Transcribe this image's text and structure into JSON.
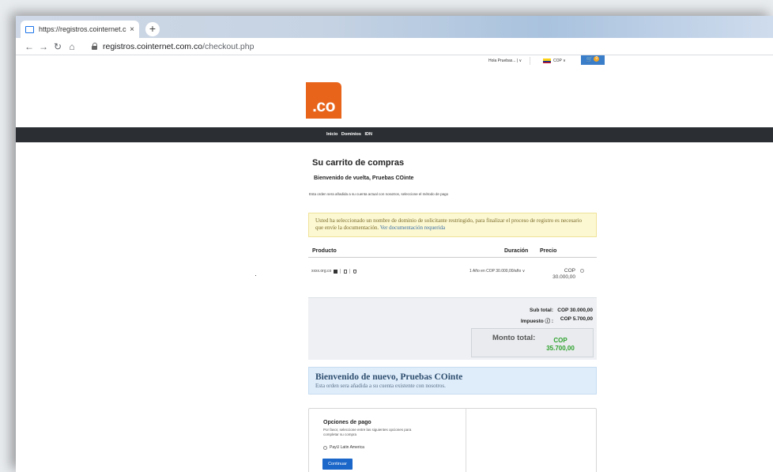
{
  "browser": {
    "tab_title": "https://registros.cointernet.com.co",
    "tab_close": "×",
    "new_tab": "+",
    "url_host": "registros.cointernet.com.co",
    "url_path": "/checkout.php",
    "icons": [
      "back-arrow-icon",
      "forward-arrow-icon",
      "reload-icon",
      "home-icon",
      "lock-icon"
    ]
  },
  "topbar": {
    "greeting": "Hola Pruebas... | ∨",
    "currency": "COP ∨",
    "cart_count": "0"
  },
  "brand": {
    "logo_text": ".co",
    "logo_color": "#e8641b"
  },
  "nav": {
    "items": [
      "Inicio",
      "Dominios",
      "IDN"
    ]
  },
  "cart": {
    "title": "Su carrito de compras",
    "welcome": "Bienvenido de vuelta, Pruebas COinte",
    "note": "Esta orden sera añadida a su cuenta actual con nosotros, seleccione el método de pago",
    "alert_text": "Usted ha seleccionado un nombre de dominio de solicitante restringido, para finalizar el proceso de registro es necesario que envíe la documentación.",
    "alert_link": "Ver documentación requerida",
    "columns": {
      "product": "Producto",
      "duration": "Duración",
      "price": "Precio"
    },
    "items": [
      {
        "domain": "xxxx.org.co",
        "duration": "1 Año en COP 30.000,00/año ∨",
        "price": "COP 30.000,00"
      }
    ],
    "subtotal_label": "Sub total:",
    "subtotal_value": "COP 30.000,00",
    "tax_label": "Impuesto ⓘ :",
    "tax_value": "COP 5.700,00",
    "total_label": "Monto total:",
    "total_value": "COP 35.700,00",
    "total_color": "#2ea22e"
  },
  "banner": {
    "title": "Bienvenido de nuevo, Pruebas COinte",
    "subtitle": "Esta orden sera añadida a su cuenta existente con nosotros."
  },
  "payment": {
    "title": "Opciones de pago",
    "description": "Por favor, seleccione entre las siguientes opciones para completar su compra",
    "option": "PayU Latin America",
    "continue_label": "Continuar"
  }
}
